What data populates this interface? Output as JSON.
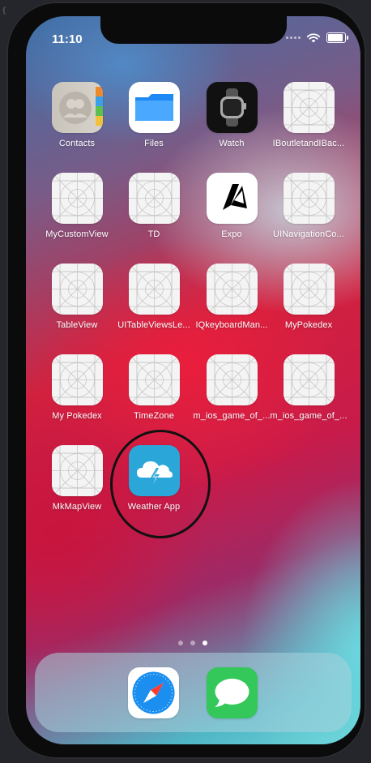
{
  "status": {
    "time": "11:10"
  },
  "apps": [
    {
      "label": "Contacts",
      "icon": "contacts-icon"
    },
    {
      "label": "Files",
      "icon": "files-icon"
    },
    {
      "label": "Watch",
      "icon": "watch-icon"
    },
    {
      "label": "IBoutletandIBac...",
      "icon": "placeholder-app-icon"
    },
    {
      "label": "MyCustomView",
      "icon": "placeholder-app-icon"
    },
    {
      "label": "TD",
      "icon": "placeholder-app-icon"
    },
    {
      "label": "Expo",
      "icon": "expo-icon"
    },
    {
      "label": "UINavigationCo...",
      "icon": "placeholder-app-icon"
    },
    {
      "label": "TableView",
      "icon": "placeholder-app-icon"
    },
    {
      "label": "UITableViewsLe...",
      "icon": "placeholder-app-icon"
    },
    {
      "label": "IQkeyboardMan...",
      "icon": "placeholder-app-icon"
    },
    {
      "label": "MyPokedex",
      "icon": "placeholder-app-icon"
    },
    {
      "label": "My Pokedex",
      "icon": "placeholder-app-icon"
    },
    {
      "label": "TimeZone",
      "icon": "placeholder-app-icon"
    },
    {
      "label": "m_ios_game_of_...",
      "icon": "placeholder-app-icon"
    },
    {
      "label": "m_ios_game_of_...",
      "icon": "placeholder-app-icon"
    },
    {
      "label": "MkMapView",
      "icon": "placeholder-app-icon"
    },
    {
      "label": "Weather App",
      "icon": "weather-app-icon"
    }
  ],
  "dock": [
    {
      "icon": "safari-icon"
    },
    {
      "icon": "messages-icon"
    }
  ],
  "pages": {
    "current": 3,
    "total": 3
  },
  "colors": {
    "weather": "#2aa7d8",
    "messages": "#34c759",
    "files": "#1e88f5"
  }
}
